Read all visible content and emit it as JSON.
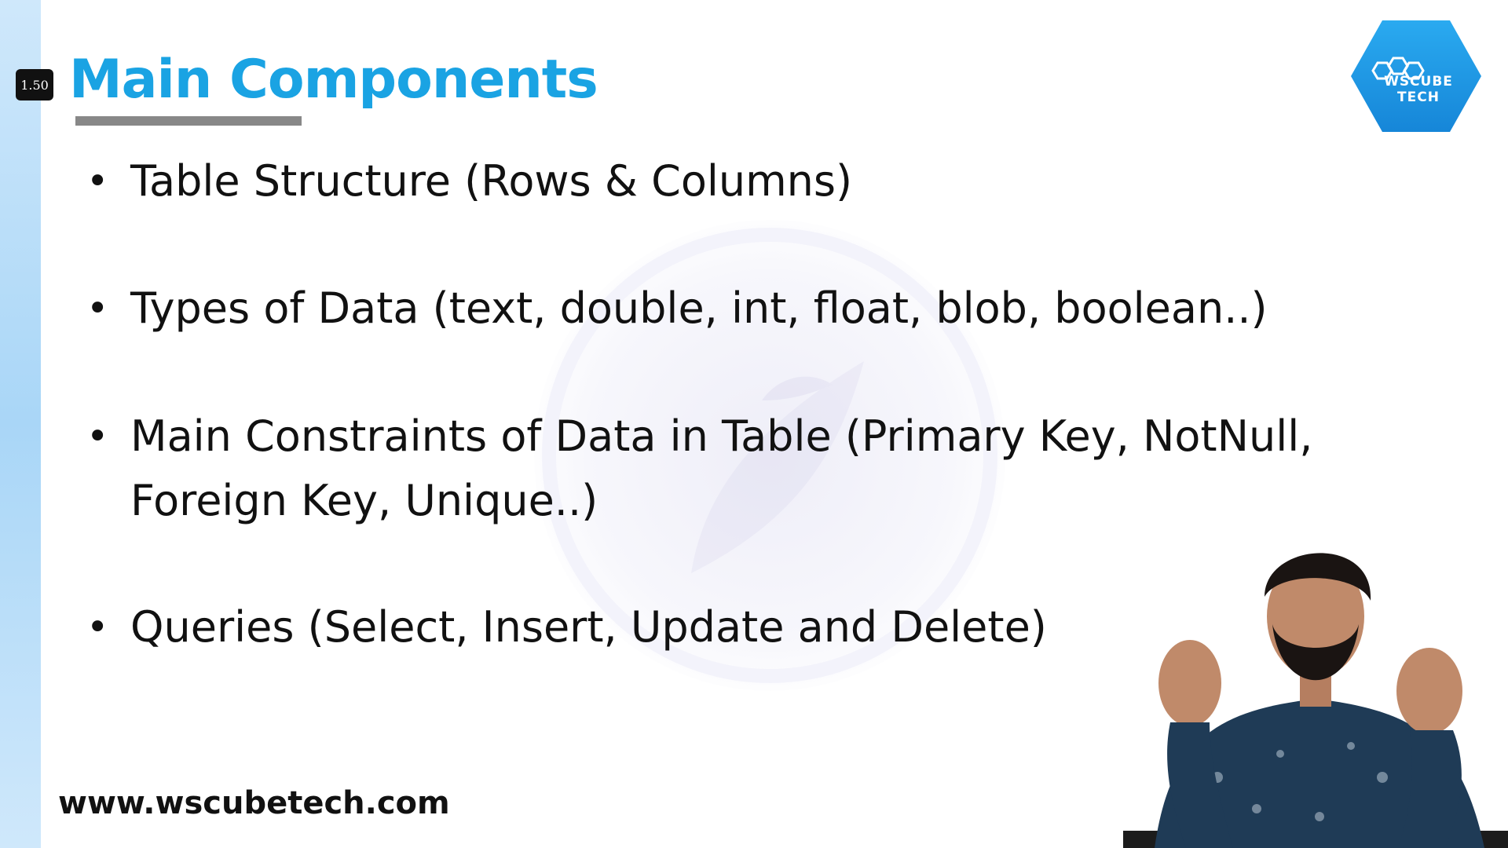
{
  "player": {
    "speed_label": "1.50"
  },
  "slide": {
    "title": "Main Components",
    "title_color": "#1aa3e3",
    "bullets": [
      "Table Structure (Rows & Columns)",
      "Types of Data (text, double, int, float, blob, boolean..)",
      "Main Constraints of Data in Table (Primary Key, NotNull, Foreign Key, Unique..)",
      "Queries (Select, Insert, Update and Delete)"
    ],
    "website": "www.wscubetech.com"
  },
  "logo": {
    "text": "WsCube Tech",
    "color": "#1e9be6",
    "icon": "wscube-hexagon-logo"
  },
  "presenter": {
    "icon": "presenter-video-overlay"
  }
}
